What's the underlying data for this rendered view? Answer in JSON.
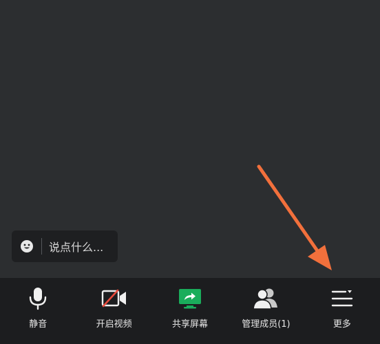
{
  "chat": {
    "placeholder": "说点什么...",
    "icon": "smiley-icon"
  },
  "toolbar": {
    "items": [
      {
        "label": "静音",
        "icon": "microphone-icon"
      },
      {
        "label": "开启视频",
        "icon": "video-camera-off-icon"
      },
      {
        "label": "共享屏幕",
        "icon": "share-screen-icon"
      },
      {
        "label": "管理成员(1)",
        "icon": "members-icon"
      },
      {
        "label": "更多",
        "icon": "more-menu-icon"
      }
    ]
  },
  "colors": {
    "background": "#2c2e30",
    "toolbar": "#1c1d1f",
    "accent_green": "#1aad5b",
    "arrow": "#f2703c",
    "camera_off_red": "#e84a3c"
  }
}
